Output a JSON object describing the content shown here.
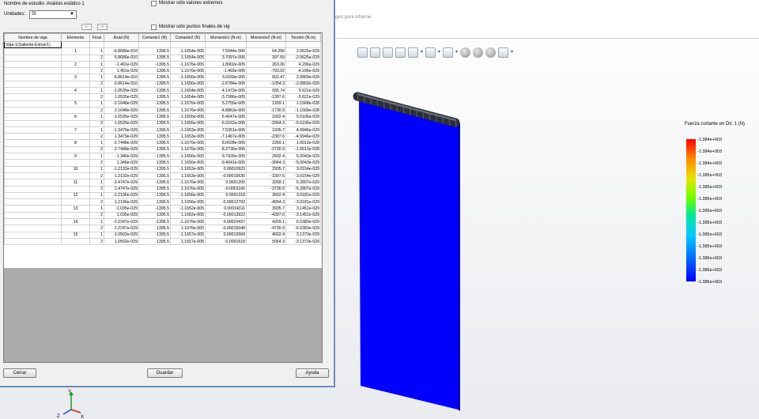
{
  "dialog": {
    "study_label": "Nombre de estudio: Análisis estático 1",
    "units_label": "Unidades:",
    "units_value": "SI",
    "extremes_label": "Mostrar sólo valores extremos",
    "endpoints_label": "Mostrar sólo puntos finales de vig",
    "prev_label": "<-",
    "next_label": "->",
    "close_label": "Cerrar",
    "save_label": "Guardar",
    "help_label": "Ayuda"
  },
  "table": {
    "headers": [
      "Nombre de viga",
      "Elemento",
      "Final",
      "Axial (N)",
      "Cortante1 (N)",
      "Cortante2 (N)",
      "Momento1 (N.m)",
      "Momento2 (N.m)",
      "Torsión (N.m)"
    ],
    "beam_name": "Viga-1(Saliente-Extruir1)",
    "rows": [
      [
        "1",
        "1",
        "-6.8686e-010",
        "1395.5",
        "-1.1654e-005",
        "7.5944e-006",
        "64.256",
        "2.0625e-029"
      ],
      [
        "",
        "2",
        "6.8686e-010",
        "1395.5",
        "1.1654e-005",
        "3.7097e-006",
        "397.59",
        "-2.0625e-029"
      ],
      [
        "2",
        "1",
        "-1.401e-029",
        "-1395.5",
        "-1.1676e-005",
        "1.8902e-005",
        "263.06",
        "4.296e-029"
      ],
      [
        "",
        "2",
        "1.401e-029",
        "1395.5",
        "1.1676e-005",
        "-1.493e-005",
        "-793.02",
        "-4.296e-029"
      ],
      [
        "3",
        "1",
        "-6.8614e-010",
        "1395.5",
        "-1.1656e-005",
        "3.0169e-005",
        "602.47",
        "2.0803e-029"
      ],
      [
        "",
        "2",
        "6.8614e-010",
        "-1395.5",
        "1.1656e-005",
        "-2.6784e-005",
        "-1054.3",
        "-2.0803e-029"
      ],
      [
        "4",
        "1",
        "-1.0535e-029",
        "-1395.5",
        "-1.1654e-005",
        "4.1473e-005",
        "935.74",
        "5.621e-029"
      ],
      [
        "",
        "2",
        "1.0535e-029",
        "1395.5",
        "1.1654e-005",
        "-3.7586e-005",
        "-1397.6",
        "-5.621e-029"
      ],
      [
        "5",
        "1",
        "-2.1648e-029",
        "-1395.5",
        "-1.1676e-005",
        "5.2755e-005",
        "1269.1",
        "1.1568e-028"
      ],
      [
        "",
        "2",
        "2.1648e-029",
        "1395.5",
        "1.1676e-005",
        "-4.8863e-005",
        "-1730.9",
        "-1.1568e-028"
      ],
      [
        "6",
        "1",
        "-1.0535e-029",
        "-1395.5",
        "-1.1655e-005",
        "6.4047e-005",
        "1602.4",
        "5.6106e-029"
      ],
      [
        "",
        "2",
        "1.0535e-029",
        "1395.5",
        "1.1655e-005",
        "-6.0162e-005",
        "-2064.3",
        "-5.6106e-029"
      ],
      [
        "7",
        "1",
        "-1.3479e-029",
        "-1395.5",
        "-1.1653e-005",
        "7.5351e-005",
        "1935.7",
        "4.9946e-029"
      ],
      [
        "",
        "2",
        "1.3479e-029",
        "1395.5",
        "1.1653e-005",
        "-7.1467e-005",
        "-2397.6",
        "-4.9946e-029"
      ],
      [
        "8",
        "1",
        "-2.7448e-029",
        "-1395.5",
        "-1.1676e-005",
        "8.6628e-005",
        "2269.1",
        "1.0013e-028"
      ],
      [
        "",
        "2",
        "2.7448e-029",
        "1395.5",
        "1.1676e-005",
        "-8.2736e-005",
        "-2730.9",
        "-1.0013e-028"
      ],
      [
        "9",
        "1",
        "-1.346e-029",
        "-1395.5",
        "-1.1656e-005",
        "9.7926e-005",
        "2602.4",
        "5.0043e-029"
      ],
      [
        "",
        "2",
        "1.346e-029",
        "1395.5",
        "1.1656e-005",
        "-9.4041e-005",
        "-3064.3",
        "-5.0043e-029"
      ],
      [
        "10",
        "1",
        "-1.2132e-029",
        "-1395.5",
        "-1.1653e-005",
        "0.00010923",
        "2935.7",
        "3.0154e-029"
      ],
      [
        "",
        "2",
        "1.2132e-029",
        "1395.5",
        "1.1653e-005",
        "-0.00010535",
        "-3397.6",
        "-3.0154e-029"
      ],
      [
        "11",
        "1",
        "-2.4747e-029",
        "-1395.5",
        "-1.1676e-005",
        "0.0001205",
        "3269.1",
        "5.2807e-029"
      ],
      [
        "",
        "2",
        "2.4747e-029",
        "1395.5",
        "1.1676e-005",
        "-0.0001166",
        "-3730.9",
        "-5.2807e-029"
      ],
      [
        "12",
        "1",
        "-1.2196e-029",
        "-1395.5",
        "-1.1656e-005",
        "0.0001318",
        "3602.4",
        "3.0181e-029"
      ],
      [
        "",
        "2",
        "1.2196e-029",
        "1395.5",
        "1.1656e-005",
        "-0.00012792",
        "-4064.3",
        "-3.0181e-029"
      ],
      [
        "13",
        "1",
        "-1.035e-029",
        "-1395.5",
        "-1.1652e-005",
        "0.00014311",
        "3935.7",
        "3.1451e-029"
      ],
      [
        "",
        "2",
        "1.035e-029",
        "1395.5",
        "1.1652e-005",
        "-0.00013922",
        "-4397.6",
        "-3.1451e-029"
      ],
      [
        "14",
        "1",
        "-2.2247e-029",
        "-1395.5",
        "-1.1676e-005",
        "0.00015437",
        "4269.1",
        "6.5383e-029"
      ],
      [
        "",
        "2",
        "2.2247e-029",
        "1395.5",
        "1.1676e-005",
        "-0.00015048",
        "-4730.9",
        "-6.5383e-029"
      ],
      [
        "15",
        "1",
        "-1.0502e-029",
        "-1395.5",
        "-1.1657e-005",
        "0.00016569",
        "4602.4",
        "3.1373e-029"
      ],
      [
        "",
        "2",
        "1.0502e-029",
        "1395.5",
        "1.1657e-005",
        "-0.0001618",
        "5064.3",
        "-3.1373e-029"
      ]
    ]
  },
  "viewport": {
    "report_caption": "gen para informe",
    "legend_title": "Fuerza cortante en Dir. 1 (N)",
    "legend_values": [
      "-1.384e+003",
      "-1.384e+003",
      "-1.384e+003",
      "-1.385e+003",
      "-1.385e+003",
      "-1.385e+003",
      "-1.385e+003",
      "-1.385e+003",
      "-1.385e+003",
      "-1.385e+003",
      "-1.386e+003",
      "-1.386e+003",
      "-1.386e+003"
    ],
    "triad_labels": [
      "Y",
      "Z",
      "X"
    ],
    "toolbar_icons": [
      "zoom-fit-icon",
      "zoom-area-icon",
      "zoom-in-out-icon",
      "previous-view-icon",
      "section-view-icon",
      "view-orientation-icon",
      "display-style-icon",
      "hide-show-icon",
      "edit-appearance-icon",
      "apply-scene-icon",
      "view-settings-icon"
    ],
    "colors": {
      "plate": "#0000ff",
      "beam": "#2b2f36",
      "accent": "#6f8fb5"
    }
  }
}
